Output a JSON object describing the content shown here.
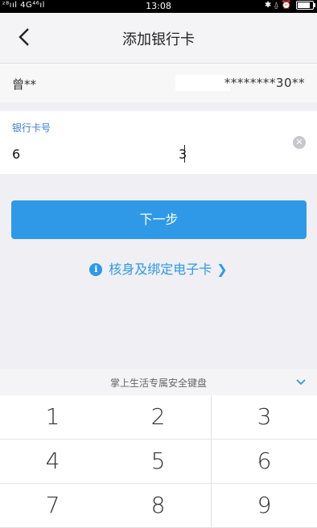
{
  "status_bar": {
    "signal": "ᶻ⁸ııl 4G⁴⁶ıl",
    "time": "13:08",
    "icons": "✱ ⍙ ⏰",
    "battery_level": 0.85
  },
  "nav": {
    "title": "添加银行卡",
    "back_icon": "chevron-left-icon"
  },
  "account": {
    "name": "曾**",
    "id_number": "********30**"
  },
  "card": {
    "label": "银行卡号",
    "value_start": "6",
    "value_end": "3"
  },
  "next_button": {
    "label": "下一步"
  },
  "verify_link": {
    "label": "核身及绑定电子卡",
    "icon": "i",
    "chevron": "❯"
  },
  "keyboard": {
    "title": "掌上生活专属安全键盘",
    "keys": [
      "1",
      "2",
      "3",
      "4",
      "5",
      "6",
      "7",
      "8",
      "9"
    ]
  }
}
